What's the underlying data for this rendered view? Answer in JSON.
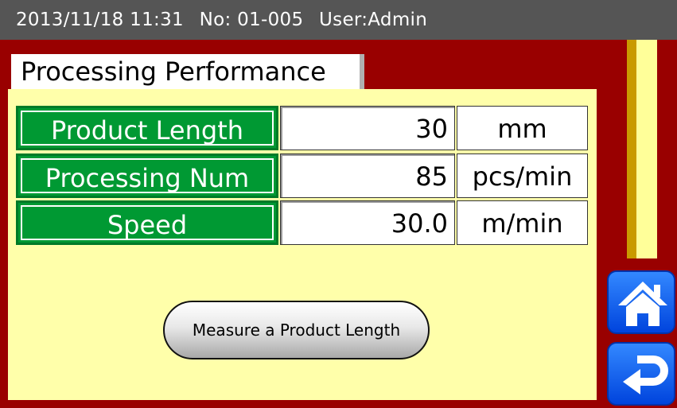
{
  "status": {
    "datetime": "2013/11/18  11:31",
    "number": "No: 01-005",
    "user": "User:Admin"
  },
  "page_title": "Processing Performance",
  "params": [
    {
      "label": "Product Length",
      "value": "30",
      "unit": "mm"
    },
    {
      "label": "Processing Num",
      "value": "85",
      "unit": "pcs/min"
    },
    {
      "label": "Speed",
      "value": "30.0",
      "unit": "m/min"
    }
  ],
  "measure_button": "Measure a Product Length",
  "nav": {
    "home_icon": "home-icon",
    "back_icon": "return-arrow-icon"
  },
  "colors": {
    "background": "#990000",
    "panel": "#ffffaa",
    "label_green": "#009933",
    "nav_blue": "#1a66ff"
  }
}
